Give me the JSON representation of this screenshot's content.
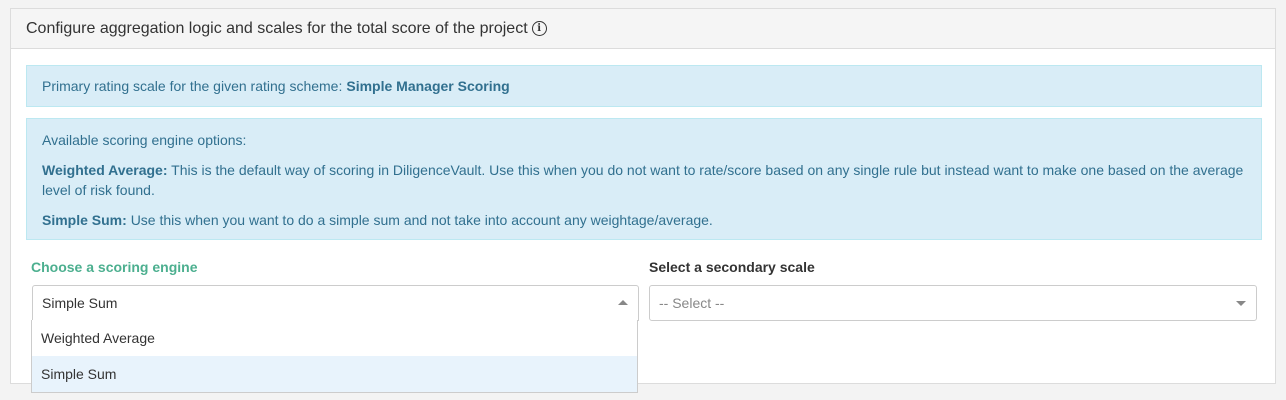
{
  "panel": {
    "title": "Configure aggregation logic and scales for the total score of the project",
    "info_icon": "info-circle-icon"
  },
  "primary_alert": {
    "text": "Primary rating scale for the given rating scheme:",
    "scale_name": "Simple Manager Scoring"
  },
  "options_alert": {
    "heading": "Available scoring engine options:",
    "weighted_label": "Weighted Average:",
    "weighted_text": "This is the default way of scoring in DiligenceVault. Use this when you do not want to rate/score based on any single rule but instead want to make one based on the average level of risk found.",
    "simple_label": "Simple Sum:",
    "simple_text": "Use this when you want to do a simple sum and not take into account any weightage/average."
  },
  "engine_field": {
    "label": "Choose a scoring engine",
    "selected": "Simple Sum",
    "options": [
      "Weighted Average",
      "Simple Sum"
    ],
    "label_color": "#4caf8f"
  },
  "scale_field": {
    "label": "Select a secondary scale",
    "placeholder": "-- Select --"
  },
  "colors": {
    "alert_bg": "#d9edf7",
    "alert_text": "#31708f",
    "highlight": "#e8f3fc"
  }
}
